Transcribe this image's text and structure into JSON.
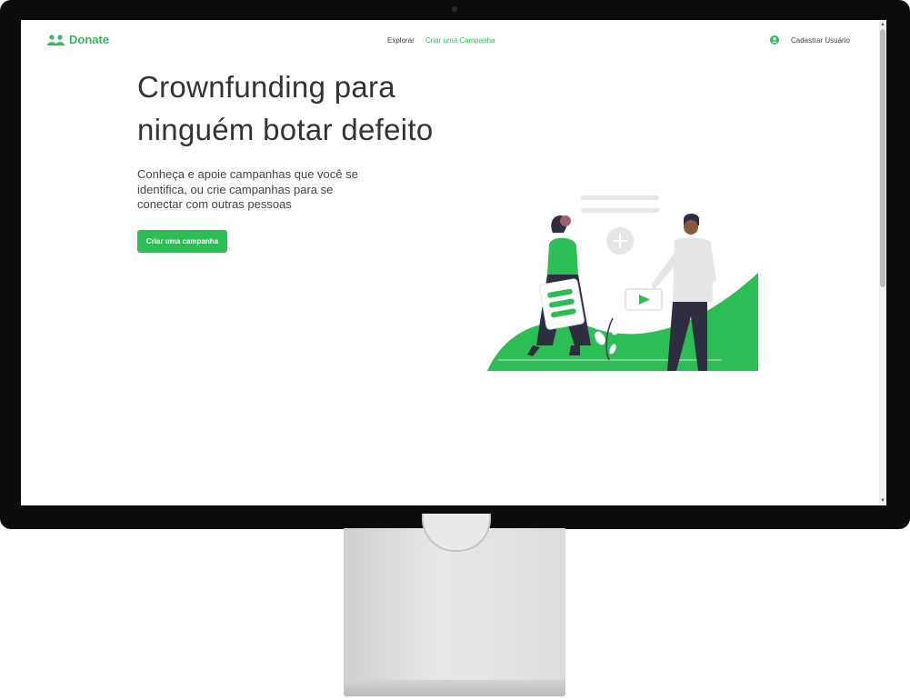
{
  "brand": {
    "name": "Donate",
    "icon": "users-icon",
    "color": "#2dbd55"
  },
  "nav": {
    "links": [
      {
        "label": "Explorar",
        "active": false
      },
      {
        "label": "Criar uma Campanha",
        "active": true
      }
    ],
    "user": {
      "icon": "user-circle-icon",
      "label": "Cadastrar Usuário"
    }
  },
  "hero": {
    "title_line1": "Crownfunding para",
    "title_line2": "ninguém botar defeito",
    "subtitle": "Conheça e apoie campanhas que você se identifica, ou crie campanhas para se conectar com outras pessoas",
    "cta_label": "Criar uma campanha"
  },
  "colors": {
    "accent": "#2dbd55",
    "text": "#333333",
    "bezel": "#0c0c0c"
  }
}
